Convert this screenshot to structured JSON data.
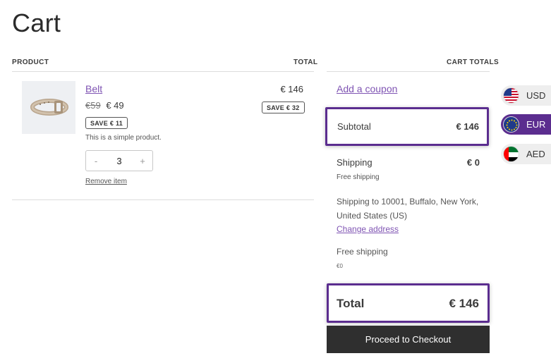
{
  "page": {
    "title": "Cart"
  },
  "table": {
    "col_product": "PRODUCT",
    "col_total": "TOTAL",
    "col_cart_totals": "CART TOTALS"
  },
  "item": {
    "name": "Belt",
    "price_old": "€59",
    "price_new": "€ 49",
    "save_badge": "SAVE € 11",
    "description": "This is a simple product.",
    "qty_minus": "-",
    "qty_value": "3",
    "qty_plus": "+",
    "remove_label": "Remove item",
    "line_total": "€ 146",
    "line_save": "SAVE € 32"
  },
  "totals": {
    "coupon_link": "Add a coupon",
    "subtotal_label": "Subtotal",
    "subtotal_value": "€ 146",
    "shipping_label": "Shipping",
    "shipping_value": "€ 0",
    "shipping_method": "Free shipping",
    "shipping_to": "Shipping to 10001, Buffalo, New York, United States (US)",
    "change_address": "Change address",
    "free_shipping_label": "Free shipping",
    "free_shipping_value": "€0",
    "total_label": "Total",
    "total_value": "€ 146",
    "checkout_label": "Proceed to Checkout"
  },
  "currency_switcher": {
    "items": [
      {
        "code": "USD",
        "flag": "us-flag-icon",
        "active": false
      },
      {
        "code": "EUR",
        "flag": "eu-flag-icon",
        "active": true
      },
      {
        "code": "AED",
        "flag": "ae-flag-icon",
        "active": false
      }
    ],
    "active_color": "#5b2d8f"
  },
  "colors": {
    "link": "#7f54b3",
    "highlight_border": "#5b2d8f",
    "checkout_bg": "#2f2f2f"
  }
}
